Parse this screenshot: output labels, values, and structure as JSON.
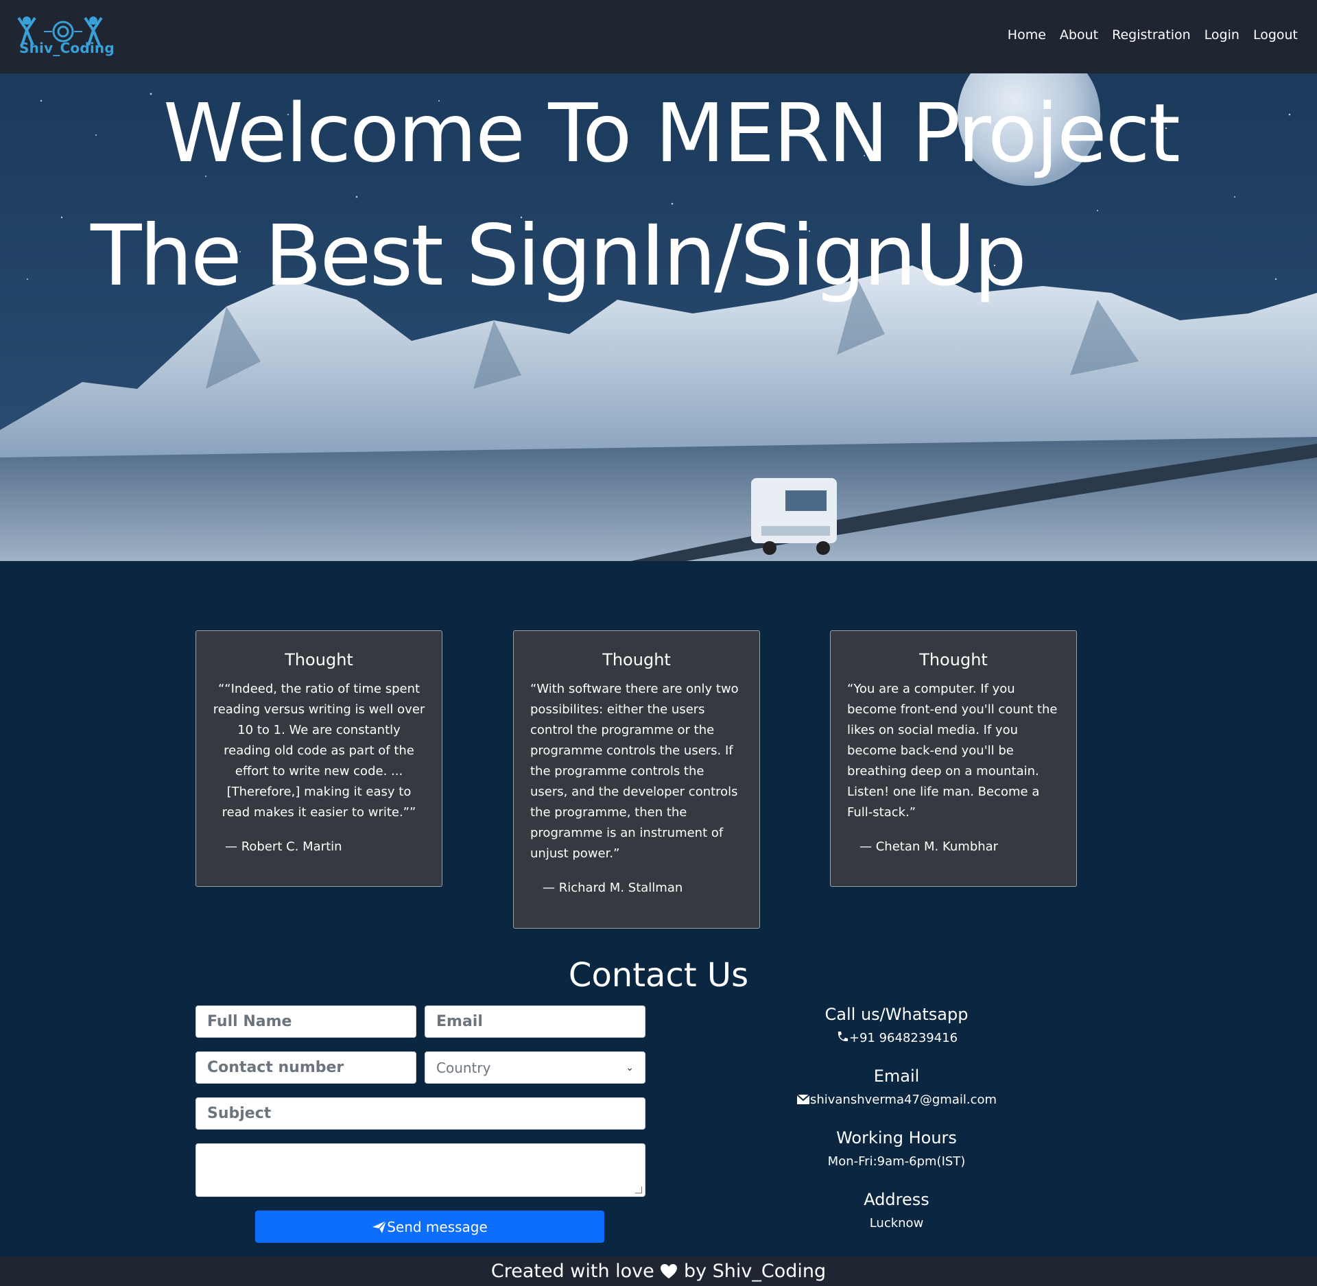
{
  "brand": {
    "logo_text": "Shiv_Coding"
  },
  "nav": {
    "home": "Home",
    "about": "About",
    "registration": "Registration",
    "login": "Login",
    "logout": "Logout"
  },
  "hero": {
    "title_line1": "Welcome To MERN Project",
    "title_line2": "The Best SignIn/SignUp"
  },
  "thoughts": [
    {
      "heading": "Thought",
      "quote": "““Indeed, the ratio of time spent reading versus writing is well over 10 to 1. We are constantly reading old code as part of the effort to write new code. ...[Therefore,] making it easy to read makes it easier to write.””",
      "author": "— Robert C. Martin"
    },
    {
      "heading": "Thought",
      "quote": "“With software there are only two possibilites: either the users control the programme or the programme controls the users. If the programme controls the users, and the developer controls the programme, then the programme is an instrument of unjust power.”",
      "author": "— Richard M. Stallman"
    },
    {
      "heading": "Thought",
      "quote": "“You are a computer. If you become front-end you'll count the likes on social media. If you become back-end you'll be breathing deep on a mountain. Listen! one life man. Become a Full-stack.”",
      "author": "— Chetan M. Kumbhar"
    }
  ],
  "contact": {
    "title": "Contact Us",
    "full_name_placeholder": "Full Name",
    "email_placeholder": "Email",
    "contact_number_placeholder": "Contact number",
    "country_selected": "Country",
    "subject_placeholder": "Subject",
    "message_value": "",
    "send_label": "Send message"
  },
  "info": {
    "call_heading": "Call us/Whatsapp",
    "call_value": "+91 9648239416",
    "email_heading": "Email",
    "email_value": "shivanshverma47@gmail.com",
    "hours_heading": "Working Hours",
    "hours_value": "Mon-Fri:9am-6pm(IST)",
    "address_heading": "Address",
    "address_value": "Lucknow"
  },
  "footer": {
    "text_before": "Created with love",
    "text_after": "by Shiv_Coding"
  },
  "icons": {
    "heart": "heart-icon",
    "phone": "phone-icon",
    "envelope": "envelope-icon",
    "paper_plane": "paper-plane-icon"
  },
  "colors": {
    "navbar_bg": "#1f2631",
    "page_bg": "#0a2640",
    "card_bg": "#343a40",
    "button_bg": "#0d6efd",
    "logo_accent": "#3aa0d8"
  }
}
